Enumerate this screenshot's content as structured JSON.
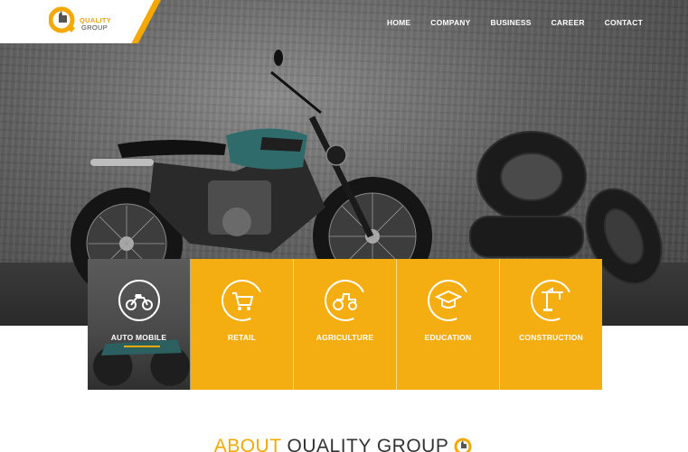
{
  "brand": {
    "line1": "QUALITY",
    "line2": "GROUP",
    "accent": "#f5a800"
  },
  "nav": {
    "items": [
      {
        "label": "HOME"
      },
      {
        "label": "COMPANY"
      },
      {
        "label": "BUSINESS"
      },
      {
        "label": "CAREER"
      },
      {
        "label": "CONTACT"
      }
    ]
  },
  "hero": {
    "image": "motorcycle-with-tires-icon"
  },
  "categories": [
    {
      "label": "AUTO MOBILE",
      "icon": "motorcycle-icon",
      "active": true
    },
    {
      "label": "RETAIL",
      "icon": "shopping-cart-icon",
      "active": false
    },
    {
      "label": "AGRICULTURE",
      "icon": "tractor-icon",
      "active": false
    },
    {
      "label": "EDUCATION",
      "icon": "graduation-cap-icon",
      "active": false
    },
    {
      "label": "CONSTRUCTION",
      "icon": "crane-icon",
      "active": false
    }
  ],
  "about": {
    "word1": "ABOUT",
    "word2": "QUALITY GROUP"
  }
}
